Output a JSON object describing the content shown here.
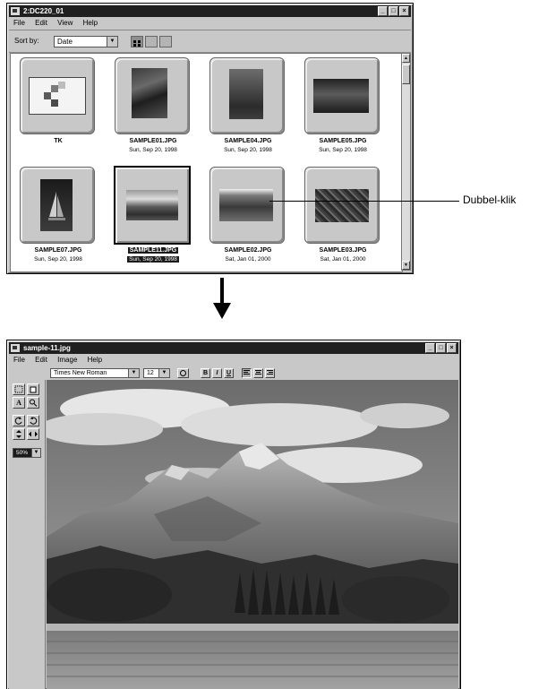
{
  "window1": {
    "title": "2:DC220_01",
    "menus": [
      "File",
      "Edit",
      "View",
      "Help"
    ],
    "sort_label": "Sort by:",
    "sort_value": "Date",
    "thumbnails": [
      {
        "name": "TK",
        "date": ""
      },
      {
        "name": "SAMPLE01.JPG",
        "date": "Sun, Sep 20, 1998"
      },
      {
        "name": "SAMPLE04.JPG",
        "date": "Sun, Sep 20, 1998"
      },
      {
        "name": "SAMPLE05.JPG",
        "date": "Sun, Sep 20, 1998"
      },
      {
        "name": "SAMPLE07.JPG",
        "date": "Sun, Sep 20, 1998"
      },
      {
        "name": "SAMPLE11.JPG",
        "date": "Sun, Sep 20, 1998"
      },
      {
        "name": "SAMPLE02.JPG",
        "date": "Sat, Jan 01, 2000"
      },
      {
        "name": "SAMPLE03.JPG",
        "date": "Sat, Jan 01, 2000"
      }
    ]
  },
  "callout": {
    "label": "Dubbel-klik"
  },
  "window2": {
    "title": "sample-11.jpg",
    "menus": [
      "File",
      "Edit",
      "Image",
      "Help"
    ],
    "font_name": "Times New Roman",
    "font_size": "12",
    "format_buttons": {
      "bold": "B",
      "italic": "I",
      "underline": "U"
    },
    "zoom": "50%"
  },
  "colors": {
    "titlebar": "#202020",
    "window": "#c8c8c8",
    "selection": "#1a1a1a"
  }
}
